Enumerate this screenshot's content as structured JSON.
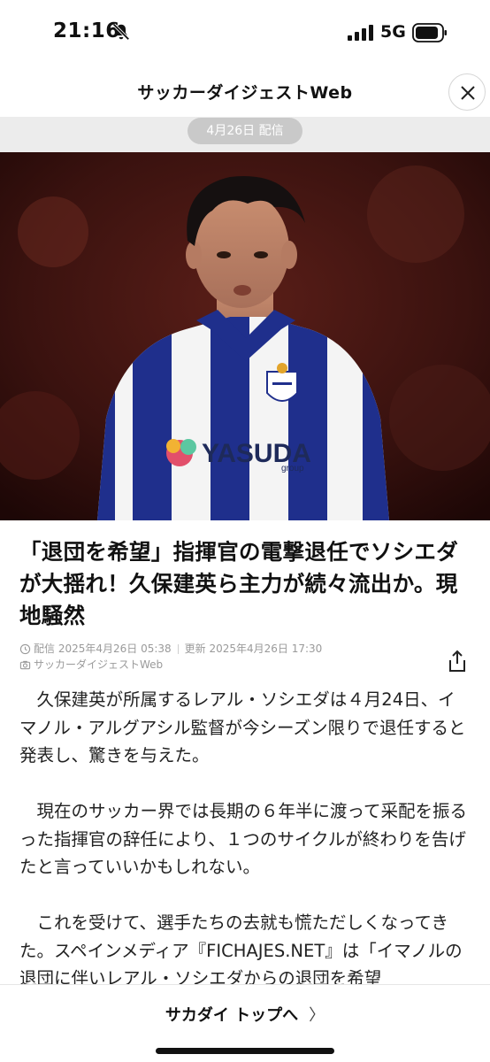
{
  "status_bar": {
    "time": "21:16",
    "network": "5G"
  },
  "header": {
    "title": "サッカーダイジェストWeb"
  },
  "date_pill": "4月26日 配信",
  "hero": {
    "sponsor_text": "YASUDA",
    "sponsor_sub": "group"
  },
  "article": {
    "headline": "「退団を希望」指揮官の電撃退任でソシエダが大揺れ！久保建英ら主力が続々流出か。現地騒然",
    "published": "配信 2025年4月26日 05:38",
    "updated": "更新 2025年4月26日 17:30",
    "source": "サッカーダイジェストWeb",
    "paragraphs": [
      "久保建英が所属するレアル・ソシエダは４月24日、イマノル・アルグアシル監督が今シーズン限りで退任すると発表し、驚きを与えた。",
      "現在のサッカー界では長期の６年半に渡って采配を振るった指揮官の辞任により、１つのサイクルが終わりを告げたと言っていいかもしれない。",
      "これを受けて、選手たちの去就も慌ただしくなってきた。スペインメディア『FICHAJES.NET』は「イマノルの退団に伴いレアル・ソシエダからの退団を希望"
    ]
  },
  "footer": {
    "link_label": "サカダイ トップへ",
    "chevron": "〉"
  },
  "colors": {
    "accent": "#111111",
    "date_pill_bg": "#c9c9c9",
    "kit_blue": "#1f2f8c"
  }
}
